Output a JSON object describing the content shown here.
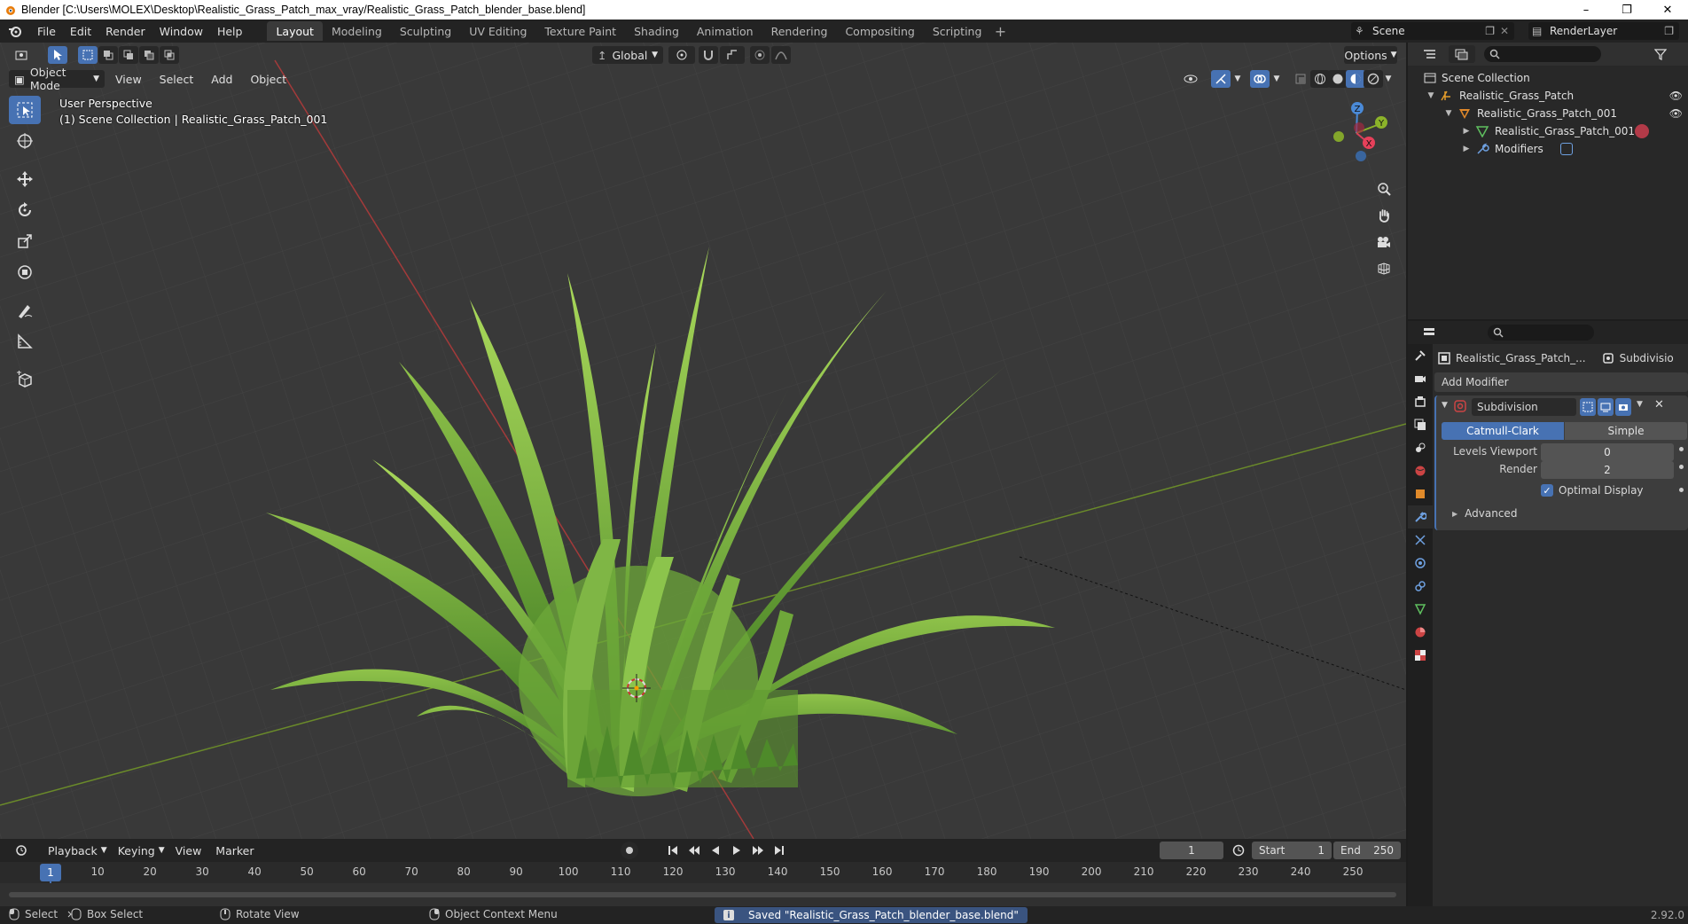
{
  "window": {
    "title": "Blender [C:\\Users\\MOLEX\\Desktop\\Realistic_Grass_Patch_max_vray/Realistic_Grass_Patch_blender_base.blend]"
  },
  "menu": [
    "File",
    "Edit",
    "Render",
    "Window",
    "Help"
  ],
  "workspaces": [
    "Layout",
    "Modeling",
    "Sculpting",
    "UV Editing",
    "Texture Paint",
    "Shading",
    "Animation",
    "Rendering",
    "Compositing",
    "Scripting"
  ],
  "scene": {
    "name": "Scene",
    "render_layer": "RenderLayer"
  },
  "viewport": {
    "mode": "Object Mode",
    "menus": [
      "View",
      "Select",
      "Add",
      "Object"
    ],
    "orientation": "Global",
    "options_label": "Options",
    "info_line1": "User Perspective",
    "info_line2": "(1) Scene Collection | Realistic_Grass_Patch_001",
    "gizmo": {
      "x": "X",
      "y": "Y",
      "z": "Z"
    }
  },
  "outliner": {
    "root": "Scene Collection",
    "items": [
      {
        "label": "Realistic_Grass_Patch"
      },
      {
        "label": "Realistic_Grass_Patch_001"
      },
      {
        "label": "Realistic_Grass_Patch_001"
      },
      {
        "label": "Modifiers"
      }
    ]
  },
  "properties": {
    "object_name": "Realistic_Grass_Patch_...",
    "modifier_tab": "Subdivisio",
    "add_modifier": "Add Modifier",
    "modifier_name": "Subdivision",
    "type_a": "Catmull-Clark",
    "type_b": "Simple",
    "levels_viewport_label": "Levels Viewport",
    "levels_viewport": "0",
    "render_label": "Render",
    "render_value": "2",
    "optimal_display": "Optimal Display",
    "advanced": "Advanced"
  },
  "timeline": {
    "menus": [
      "Playback",
      "Keying",
      "View",
      "Marker"
    ],
    "current_frame": "1",
    "start_label": "Start",
    "start": "1",
    "end_label": "End",
    "end": "250",
    "ticks": [
      "10",
      "20",
      "30",
      "40",
      "50",
      "60",
      "70",
      "80",
      "90",
      "100",
      "110",
      "120",
      "130",
      "140",
      "150",
      "160",
      "170",
      "180",
      "190",
      "200",
      "210",
      "220",
      "230",
      "240",
      "250"
    ],
    "playhead": "1"
  },
  "status": {
    "select": "Select",
    "box_select": "Box Select",
    "rotate_view": "Rotate View",
    "context_menu": "Object Context Menu",
    "message": "Saved \"Realistic_Grass_Patch_blender_base.blend\"",
    "version": "2.92.0"
  },
  "colors": {
    "accent": "#4772b3",
    "grass_light": "#9acd4e",
    "grass_dark": "#4e8a2a",
    "viewport_bg": "#393939"
  }
}
